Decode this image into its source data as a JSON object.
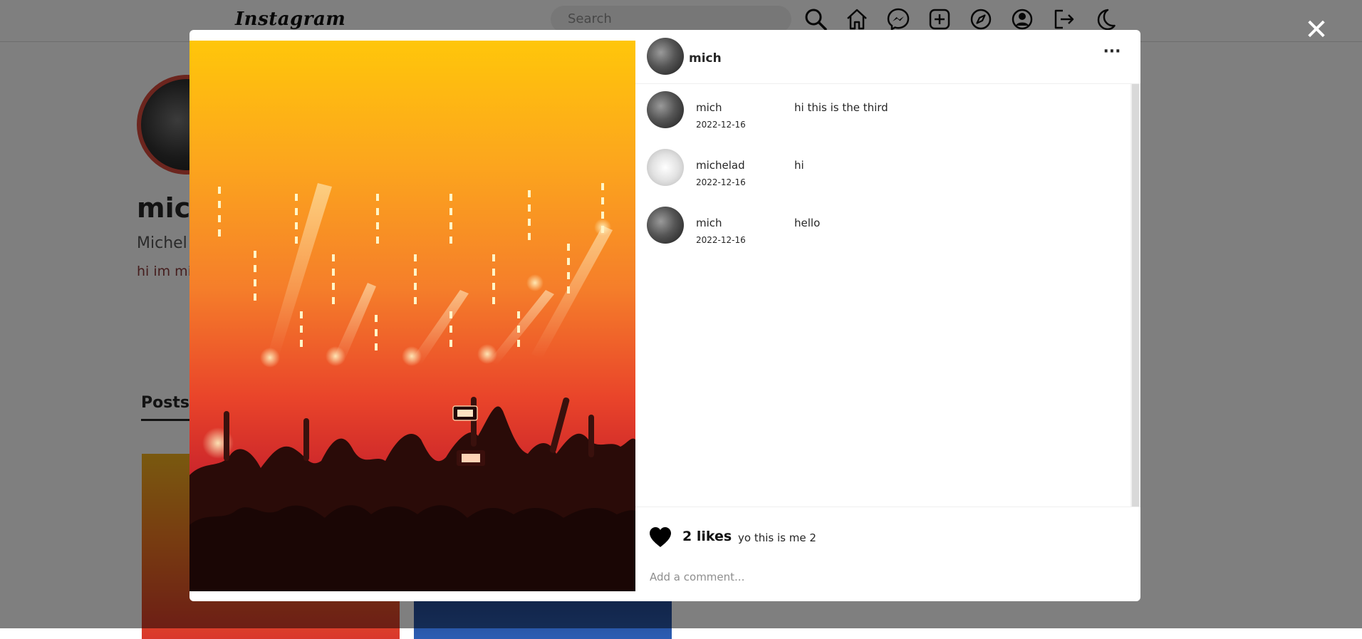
{
  "navbar": {
    "logo": "Instagram",
    "search_placeholder": "Search",
    "icons": [
      "search-icon",
      "home-icon",
      "messenger-icon",
      "add-post-icon",
      "explore-icon",
      "profile-icon",
      "logout-icon",
      "dark-mode-icon"
    ]
  },
  "profile": {
    "username": "mich",
    "fullname": "Michel A",
    "bio": "hi im mi",
    "tab_posts": "Posts"
  },
  "modal": {
    "close_symbol": "✕",
    "author": "mich",
    "more_symbol": "···",
    "comments": [
      {
        "user": "mich",
        "date": "2022-12-16",
        "text": "hi this is the third",
        "avatar": "dark"
      },
      {
        "user": "michelad",
        "date": "2022-12-16",
        "text": "hi",
        "avatar": "light"
      },
      {
        "user": "mich",
        "date": "2022-12-16",
        "text": "hello",
        "avatar": "dark"
      }
    ],
    "likes": "2 likes",
    "caption": "yo this is me 2",
    "comment_placeholder": "Add a comment..."
  },
  "colors": {
    "profile_ring": "#d84a3c",
    "overlay": "rgba(0,0,0,0.5)",
    "post_image_top": "#ffc60a",
    "post_image_bottom": "#c9232b"
  }
}
